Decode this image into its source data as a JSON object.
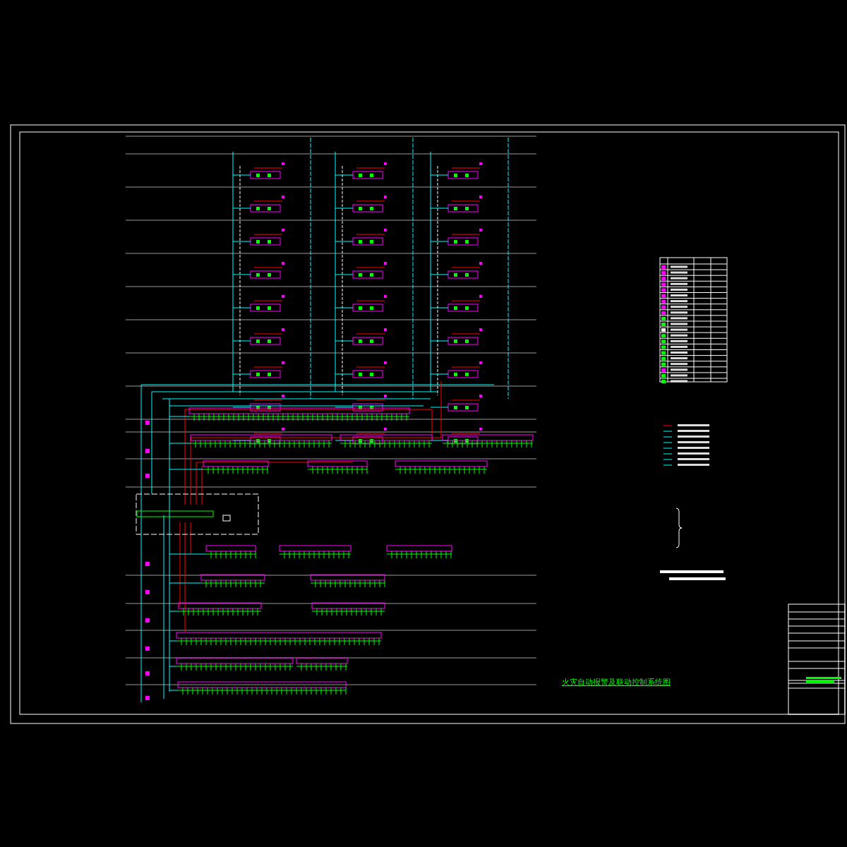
{
  "drawing": {
    "title": "火灾自动报警及联动控制系统图"
  }
}
